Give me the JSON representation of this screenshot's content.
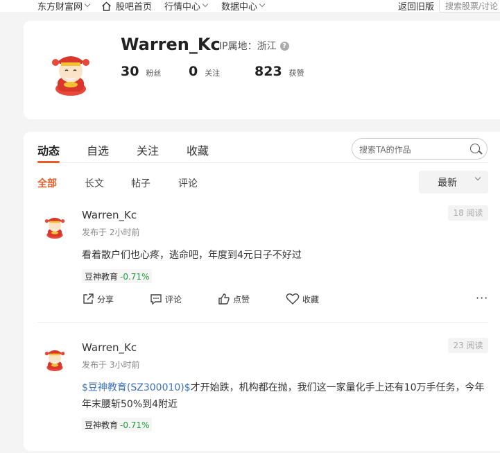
{
  "topnav": {
    "items": [
      "东方财富网",
      "股吧首页",
      "行情中心",
      "数据中心"
    ],
    "back": "返回旧版",
    "search_placeholder": "搜索股票/讨论"
  },
  "profile": {
    "username": "Warren_Kc",
    "ip_label": "IP属地：浙江",
    "stats": [
      {
        "num": "30",
        "label": "粉丝"
      },
      {
        "num": "0",
        "label": "关注"
      },
      {
        "num": "823",
        "label": "获赞"
      }
    ]
  },
  "feed": {
    "tabs": [
      "动态",
      "自选",
      "关注",
      "收藏"
    ],
    "search_placeholder": "搜索TA的作品",
    "subtabs": [
      "全部",
      "长文",
      "帖子",
      "评论"
    ],
    "sort": "最新",
    "actions": [
      "分享",
      "评论",
      "点赞",
      "收藏"
    ],
    "more": "···",
    "posts": [
      {
        "name": "Warren_Kc",
        "time": "发布于 2小时前",
        "reads": "18 阅读",
        "link": "",
        "text": "看着散户们也心疼，逃命吧，年度到4元日子不好过",
        "stock": "豆神教育",
        "change": "-0.71%"
      },
      {
        "name": "Warren_Kc",
        "time": "发布于 3小时前",
        "reads": "23 阅读",
        "link": "$豆神教育(SZ300010)$",
        "text": "才开始跌，机构都在抛，我们这一家量化手上还有10万手任务，今年年末腰斩50%到4附近",
        "stock": "豆神教育",
        "change": "-0.71%"
      }
    ]
  },
  "colors": {
    "accent": "#e85c2a",
    "down": "#1a9e3a",
    "link": "#3a6fc2"
  }
}
